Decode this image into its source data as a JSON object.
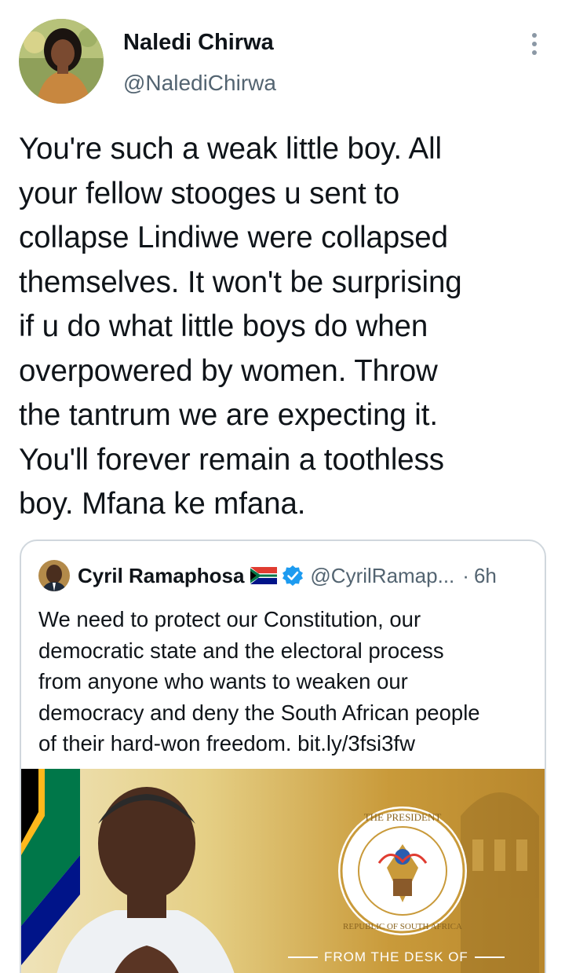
{
  "tweet": {
    "author_name": "Naledi Chirwa",
    "author_handle": "@NalediChirwa",
    "text": "You're such a weak little boy. All\nyour fellow stooges u sent to\ncollapse Lindiwe were collapsed\nthemselves. It won't be surprising\nif u do what little boys do when\noverpowered by women. Throw\nthe tantrum we are expecting it.\nYou'll forever remain a toothless\nboy. Mfana ke mfana.",
    "more_icon": "more-vertical-icon"
  },
  "quote": {
    "author_name": "Cyril Ramaphosa",
    "flag_icon": "south-africa-flag-icon",
    "verified_icon": "verified-badge-icon",
    "author_handle": "@CyrilRamap...",
    "separator": "·",
    "time": "6h",
    "text": "We need to protect our Constitution, our\ndemocratic state and the electoral process\nfrom anyone who wants to weaken our\ndemocracy and deny the South African people\nof their hard-won freedom. bit.ly/3fsi3fw",
    "image": {
      "seal_top_text": "THE PRESIDENT",
      "seal_bottom_text": "REPUBLIC OF SOUTH AFRICA",
      "caption": "FROM THE DESK OF"
    }
  },
  "colors": {
    "text_primary": "#0f1419",
    "text_secondary": "#536471",
    "verified_blue": "#1d9bf0",
    "border": "#d0d7dd",
    "gold": "#c99a3a"
  }
}
